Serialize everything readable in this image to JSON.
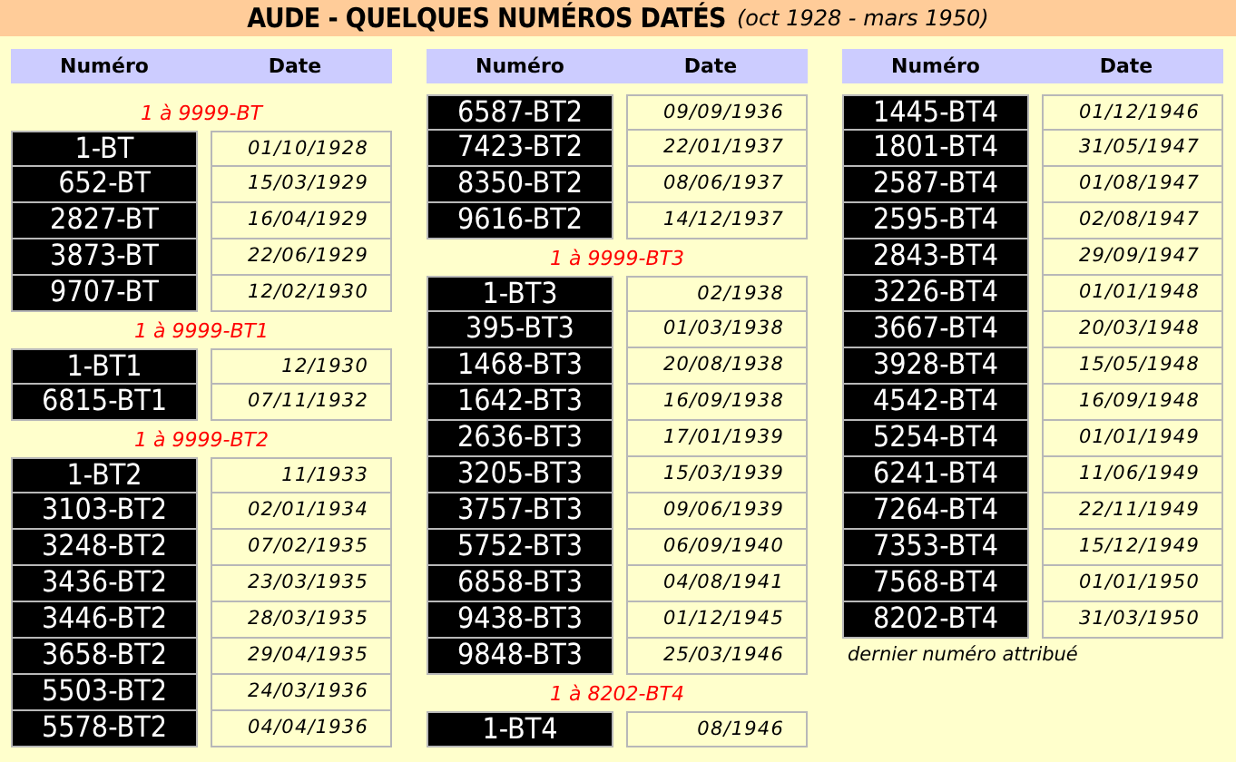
{
  "title": "AUDE - QUELQUES NUMÉROS DATÉS",
  "subtitle": "(oct 1928 - mars 1950)",
  "columns": [
    {
      "headers": [
        "Numéro",
        "Date"
      ],
      "blocks": [
        {
          "kind": "range",
          "text": "1 à 9999-BT"
        },
        {
          "kind": "group",
          "rows": [
            {
              "number": "1-BT",
              "date": "01/10/1928"
            },
            {
              "number": "652-BT",
              "date": "15/03/1929"
            },
            {
              "number": "2827-BT",
              "date": "16/04/1929"
            },
            {
              "number": "3873-BT",
              "date": "22/06/1929"
            },
            {
              "number": "9707-BT",
              "date": "12/02/1930"
            }
          ]
        },
        {
          "kind": "range",
          "text": "1 à 9999-BT1"
        },
        {
          "kind": "group",
          "rows": [
            {
              "number": "1-BT1",
              "date": "12/1930"
            },
            {
              "number": "6815-BT1",
              "date": "07/11/1932"
            }
          ]
        },
        {
          "kind": "range",
          "text": "1 à 9999-BT2"
        },
        {
          "kind": "group",
          "rows": [
            {
              "number": "1-BT2",
              "date": "11/1933"
            },
            {
              "number": "3103-BT2",
              "date": "02/01/1934"
            },
            {
              "number": "3248-BT2",
              "date": "07/02/1935"
            },
            {
              "number": "3436-BT2",
              "date": "23/03/1935"
            },
            {
              "number": "3446-BT2",
              "date": "28/03/1935"
            },
            {
              "number": "3658-BT2",
              "date": "29/04/1935"
            },
            {
              "number": "5503-BT2",
              "date": "24/03/1936"
            },
            {
              "number": "5578-BT2",
              "date": "04/04/1936"
            }
          ]
        }
      ]
    },
    {
      "headers": [
        "Numéro",
        "Date"
      ],
      "blocks": [
        {
          "kind": "group",
          "rows": [
            {
              "number": "6587-BT2",
              "date": "09/09/1936"
            },
            {
              "number": "7423-BT2",
              "date": "22/01/1937"
            },
            {
              "number": "8350-BT2",
              "date": "08/06/1937"
            },
            {
              "number": "9616-BT2",
              "date": "14/12/1937"
            }
          ]
        },
        {
          "kind": "range",
          "text": "1 à 9999-BT3"
        },
        {
          "kind": "group",
          "rows": [
            {
              "number": "1-BT3",
              "date": "02/1938"
            },
            {
              "number": "395-BT3",
              "date": "01/03/1938"
            },
            {
              "number": "1468-BT3",
              "date": "20/08/1938"
            },
            {
              "number": "1642-BT3",
              "date": "16/09/1938"
            },
            {
              "number": "2636-BT3",
              "date": "17/01/1939"
            },
            {
              "number": "3205-BT3",
              "date": "15/03/1939"
            },
            {
              "number": "3757-BT3",
              "date": "09/06/1939"
            },
            {
              "number": "5752-BT3",
              "date": "06/09/1940"
            },
            {
              "number": "6858-BT3",
              "date": "04/08/1941"
            },
            {
              "number": "9438-BT3",
              "date": "01/12/1945"
            },
            {
              "number": "9848-BT3",
              "date": "25/03/1946"
            }
          ]
        },
        {
          "kind": "range",
          "text": "1 à 8202-BT4"
        },
        {
          "kind": "group",
          "rows": [
            {
              "number": "1-BT4",
              "date": "08/1946"
            }
          ]
        }
      ]
    },
    {
      "headers": [
        "Numéro",
        "Date"
      ],
      "blocks": [
        {
          "kind": "group",
          "rows": [
            {
              "number": "1445-BT4",
              "date": "01/12/1946"
            },
            {
              "number": "1801-BT4",
              "date": "31/05/1947"
            },
            {
              "number": "2587-BT4",
              "date": "01/08/1947"
            },
            {
              "number": "2595-BT4",
              "date": "02/08/1947"
            },
            {
              "number": "2843-BT4",
              "date": "29/09/1947"
            },
            {
              "number": "3226-BT4",
              "date": "01/01/1948"
            },
            {
              "number": "3667-BT4",
              "date": "20/03/1948"
            },
            {
              "number": "3928-BT4",
              "date": "15/05/1948"
            },
            {
              "number": "4542-BT4",
              "date": "16/09/1948"
            },
            {
              "number": "5254-BT4",
              "date": "01/01/1949"
            },
            {
              "number": "6241-BT4",
              "date": "11/06/1949"
            },
            {
              "number": "7264-BT4",
              "date": "22/11/1949"
            },
            {
              "number": "7353-BT4",
              "date": "15/12/1949"
            },
            {
              "number": "7568-BT4",
              "date": "01/01/1950"
            },
            {
              "number": "8202-BT4",
              "date": "31/03/1950"
            }
          ]
        },
        {
          "kind": "note",
          "text": "dernier numéro attribué"
        }
      ]
    }
  ]
}
